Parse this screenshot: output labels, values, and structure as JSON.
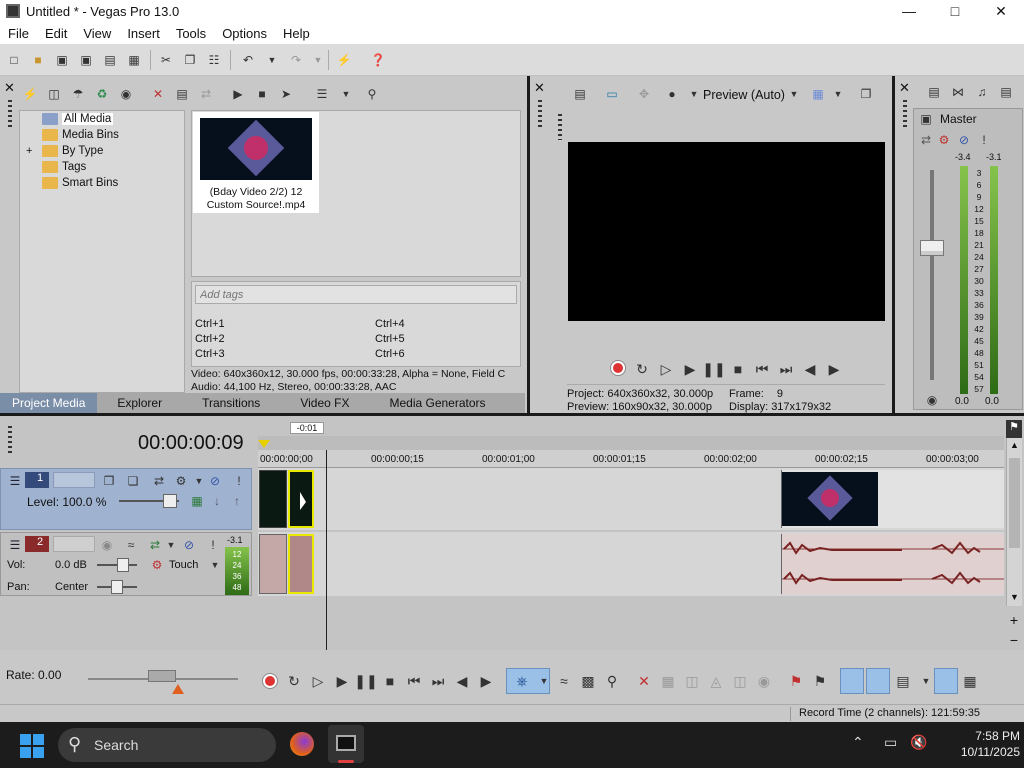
{
  "window": {
    "title": "Untitled * - Vegas Pro 13.0"
  },
  "menu": [
    "File",
    "Edit",
    "View",
    "Insert",
    "Tools",
    "Options",
    "Help"
  ],
  "explorer_tree": {
    "items": [
      {
        "label": "All Media"
      },
      {
        "label": "Media Bins"
      },
      {
        "label": "By Type",
        "expander": "+"
      },
      {
        "label": "Tags"
      },
      {
        "label": "Smart Bins"
      }
    ]
  },
  "media_item": {
    "name": "(Bday Video 2/2) 12 Custom Source!.mp4"
  },
  "tags": {
    "placeholder": "Add tags",
    "shortcuts_left": [
      "Ctrl+1",
      "Ctrl+2",
      "Ctrl+3"
    ],
    "shortcuts_right": [
      "Ctrl+4",
      "Ctrl+5",
      "Ctrl+6"
    ]
  },
  "media_info": {
    "video": "Video: 640x360x12, 30.000 fps, 00:00:33:28, Alpha = None, Field C",
    "audio": "Audio: 44,100 Hz, Stereo, 00:00:33:28, AAC"
  },
  "tabs": [
    "Project Media",
    "Explorer",
    "Transitions",
    "Video FX",
    "Media Generators"
  ],
  "preview": {
    "mode": "Preview (Auto)",
    "project_label": "Project:",
    "project_value": "640x360x32, 30.000p",
    "preview_label": "Preview:",
    "preview_value": "160x90x32, 30.000p",
    "frame_label": "Frame:",
    "frame_value": "9",
    "display_label": "Display:",
    "display_value": "317x179x32"
  },
  "master": {
    "title": "Master",
    "peak_left": "-3.4",
    "peak_right": "-3.1",
    "scale": [
      "3",
      "6",
      "9",
      "12",
      "15",
      "18",
      "21",
      "24",
      "27",
      "30",
      "33",
      "36",
      "39",
      "42",
      "45",
      "48",
      "51",
      "54",
      "57"
    ],
    "readout_left": "0.0",
    "readout_right": "0.0"
  },
  "timeline": {
    "timecode": "00:00:00:09",
    "cursor_offset": "-0:01",
    "ruler_ticks": [
      "00:00:00;00",
      "00:00:00;15",
      "00:00:01;00",
      "00:00:01;15",
      "00:00:02;00",
      "00:00:02;15",
      "00:00:03;00"
    ],
    "tracks": [
      {
        "number": "1",
        "type": "video",
        "level_label": "Level:",
        "level_value": "100.0 %"
      },
      {
        "number": "2",
        "type": "audio",
        "vol_label": "Vol:",
        "vol_value": "0.0 dB",
        "pan_label": "Pan:",
        "pan_value": "Center",
        "mode": "Touch",
        "meter_peak": "-3.1",
        "meter_scale": [
          "12",
          "24",
          "36",
          "48"
        ]
      }
    ]
  },
  "bottom": {
    "rate": "Rate: 0.00"
  },
  "status": {
    "record_time": "Record Time (2 channels): 121:59:35"
  },
  "taskbar": {
    "search_placeholder": "Search",
    "time": "7:58 PM",
    "date": "10/11/2025"
  }
}
